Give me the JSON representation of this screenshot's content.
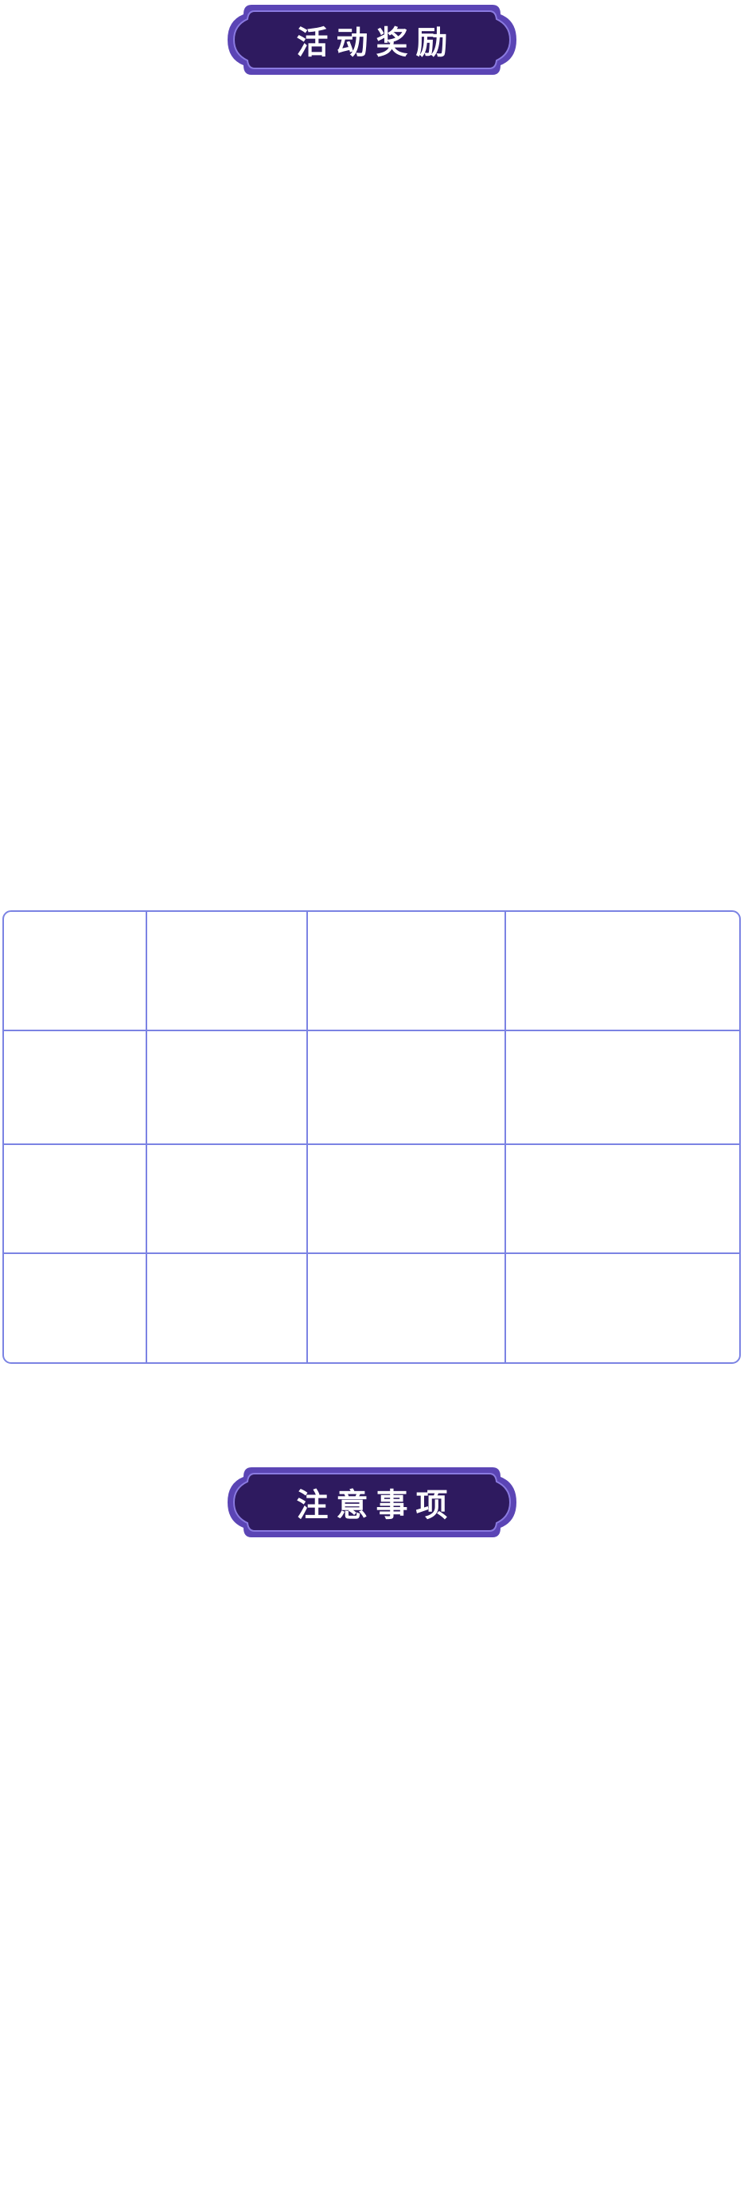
{
  "sections": {
    "rewards": {
      "title": "活动奖励"
    },
    "notes": {
      "title": "注意事项"
    }
  },
  "rewards_table": {
    "columns": 4,
    "rows": 4,
    "cells": [
      [
        "",
        "",
        "",
        ""
      ],
      [
        "",
        "",
        "",
        ""
      ],
      [
        "",
        "",
        "",
        ""
      ],
      [
        "",
        "",
        "",
        ""
      ]
    ]
  },
  "colors": {
    "plaque_fill": "#2e1a5f",
    "plaque_border": "#5b45b5",
    "table_border": "#7b83e3",
    "background": "#ffffff"
  }
}
